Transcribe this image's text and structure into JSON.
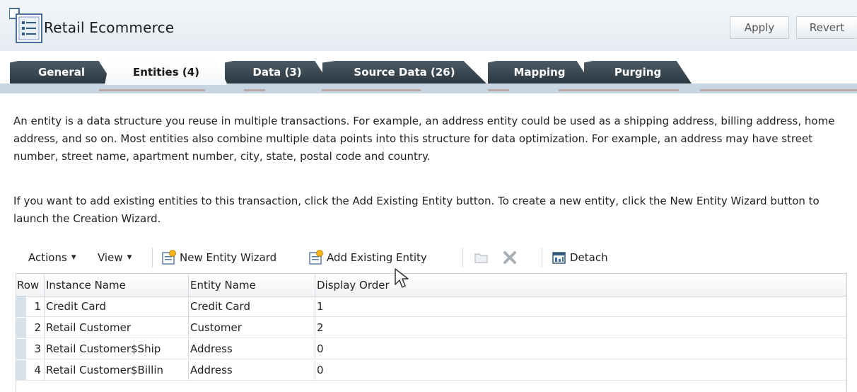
{
  "header": {
    "title": "Retail Ecommerce",
    "app_icon": "entity-list-icon",
    "apply_label": "Apply",
    "revert_label": "Revert"
  },
  "tabs": [
    {
      "label": "General",
      "active": false
    },
    {
      "label": "Entities (4)",
      "active": true
    },
    {
      "label": "Data (3)",
      "active": false
    },
    {
      "label": "Source Data (26)",
      "active": false
    },
    {
      "label": "Mapping",
      "active": false
    },
    {
      "label": "Purging",
      "active": false
    }
  ],
  "description": {
    "para1": "An entity is a data structure you reuse in multiple transactions. For example, an address entity could be used as a shipping address, billing address, home address, and so on. Most entities also combine multiple data points into this structure for data optimization. For example, an address may have street number, street name, apartment number, city, state, postal code and country.",
    "para2": "If you want to add existing entities to this transaction, click the Add Existing Entity button. To create a new entity, click the New Entity Wizard button to launch the Creation Wizard."
  },
  "toolbar": {
    "actions_label": "Actions",
    "view_label": "View",
    "new_entity_label": "New Entity Wizard",
    "add_existing_label": "Add Existing Entity",
    "detach_label": "Detach"
  },
  "table": {
    "columns": [
      "Row",
      "Instance Name",
      "Entity Name",
      "Display Order"
    ],
    "rows": [
      {
        "row": "1",
        "instance": "Credit Card",
        "entity": "Credit Card",
        "order": "1"
      },
      {
        "row": "2",
        "instance": "Retail Customer",
        "entity": "Customer",
        "order": "2"
      },
      {
        "row": "3",
        "instance": "Retail Customer$Ship",
        "entity": "Address",
        "order": "0"
      },
      {
        "row": "4",
        "instance": "Retail Customer$Billin",
        "entity": "Address",
        "order": "0"
      }
    ]
  },
  "colors": {
    "tab_dark": "#2d3840",
    "header_bg": "#e6ecf2",
    "band": "#c7d4e1"
  }
}
